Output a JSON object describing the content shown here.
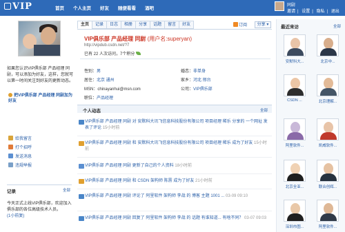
{
  "topbar": {
    "logo_text": "VIP",
    "nav": [
      "首页",
      "个人主页",
      "好友",
      "随便看看",
      "酒吧"
    ],
    "user_name": "同尉",
    "user_links": [
      "邀请",
      "设置",
      "隐私",
      "退出"
    ],
    "colors": {
      "bar": "#2e6ab8",
      "link": "#2a5fa8",
      "name_red": "#cc3322"
    }
  },
  "left": {
    "intro": "如果您认识VIP俱乐部 产品经理 同尉，可以添加为好友，这样，您就可以第一时间关注到好友的更新动态。",
    "add_friend_icon": "add-friend-icon",
    "add_friend": "把VIP俱乐部 产品经理 同尉加为好友",
    "actions": [
      {
        "icon": "mail-icon",
        "label": "给我留言",
        "color": "#d9a43a"
      },
      {
        "icon": "hand-icon",
        "label": "打个招呼",
        "color": "#e07b39"
      },
      {
        "icon": "message-icon",
        "label": "发送消息",
        "color": "#5b8fd1"
      },
      {
        "icon": "report-icon",
        "label": "违规举报",
        "color": "#7aa0c8"
      }
    ],
    "record": {
      "title": "记录",
      "all_label": "全部",
      "text": "今天正式上线VIP俱乐部，欢迎加入俱乐部的各位高级技术人员。",
      "date": "(1小前复)"
    }
  },
  "middle": {
    "tabs": [
      "主页",
      "记录",
      "日志",
      "相册",
      "分享",
      "话题",
      "留言",
      "好友"
    ],
    "active_tab": "主页",
    "subscribe": "订阅",
    "share": "分享",
    "name_title": "VIP俱乐部 产品经理 同尉",
    "username": "(用户名:superyan)",
    "url": "http://vipdub.csdn.net/?7",
    "stats": "已有 22 人次访问，7个积分",
    "profile": {
      "gender_label": "性别：",
      "gender": "男",
      "marriage_label": "婚恋：",
      "marriage": "非单身",
      "residence_label": "居住：",
      "residence": "北京 通州",
      "hometown_label": "家乡：",
      "hometown": "河北 邢台",
      "msn_label": "MSN：",
      "msn": "chinayanhui@msn.com",
      "company_label": "公司：",
      "company": "VIP俱乐部",
      "position_label": "职位：",
      "position": "产品经理"
    },
    "feed_title": "个人动态",
    "feed_all": "全部",
    "feed": [
      {
        "icon": "pencil-icon",
        "color": "#4a86c8",
        "line1": "VIP俱乐部 产品经理 同尉 对 安默科大讯飞信息科技股份有限公司 项目经理 稀乐 分享的 一个网址 发表了评论",
        "time": "15小时前"
      },
      {
        "icon": "people-icon",
        "color": "#e0a030",
        "line1": "VIP俱乐部 产品经理 同尉 和 安默科大讯飞信息科技股份有限公司 项目经理 稀乐 成为了好友",
        "time": "15小时前"
      },
      {
        "icon": "profile-icon",
        "color": "#5b8fd1",
        "line1": "VIP俱乐部 产品经理 同尉 更新了自己的个人资料",
        "time": "18小时前"
      },
      {
        "icon": "people-icon",
        "color": "#e0a030",
        "line1": "VIP俱乐部 产品经理 同尉 和 CSDN 架构师 陈雳 成为了好友",
        "time": "21小时前"
      },
      {
        "icon": "pencil-icon",
        "color": "#4a86c8",
        "line1": "VIP俱乐部 产品经理 同尉 评论了 阿里软件 架构师 李战 的 博客 主题 1001 ...",
        "time": "03-09 09:10"
      },
      {
        "icon": "pencil-icon",
        "color": "#4a86c8",
        "line1": "VIP俱乐部 产品经理 同尉 回复了 阿里软件 架构师 李战 的 话题 有谁知道... 有啥不同？",
        "time": "03-07 09:03"
      }
    ]
  },
  "right": {
    "title": "最近来访",
    "all_label": "全部",
    "visitors": [
      {
        "name": "安默科大...",
        "head": "#e8c4a8",
        "body": "#3c4a5e"
      },
      {
        "name": "北京中...",
        "head": "#d8ae8c",
        "body": "#2b3748"
      },
      {
        "name": "CSDN ...",
        "head": "#ebc6a6",
        "body": "#2d2d2d"
      },
      {
        "name": "北京理解...",
        "head": "#e3bb98",
        "body": "#445566"
      },
      {
        "name": "阿里软件...",
        "head": "#c9b8d8",
        "body": "#8a6aa8"
      },
      {
        "name": "凯威软件...",
        "head": "#e8c4a8",
        "body": "#c0392b"
      },
      {
        "name": "北京全亚...",
        "head": "#f0d2b4",
        "body": "#1f1f1f"
      },
      {
        "name": "联合创辉...",
        "head": "#e6c2a2",
        "body": "#26323f"
      },
      {
        "name": "深圳市图...",
        "head": "#e9c8a8",
        "body": "#202020"
      },
      {
        "name": "阿里软件...",
        "head": "#dfb896",
        "body": "#303a48"
      }
    ]
  }
}
